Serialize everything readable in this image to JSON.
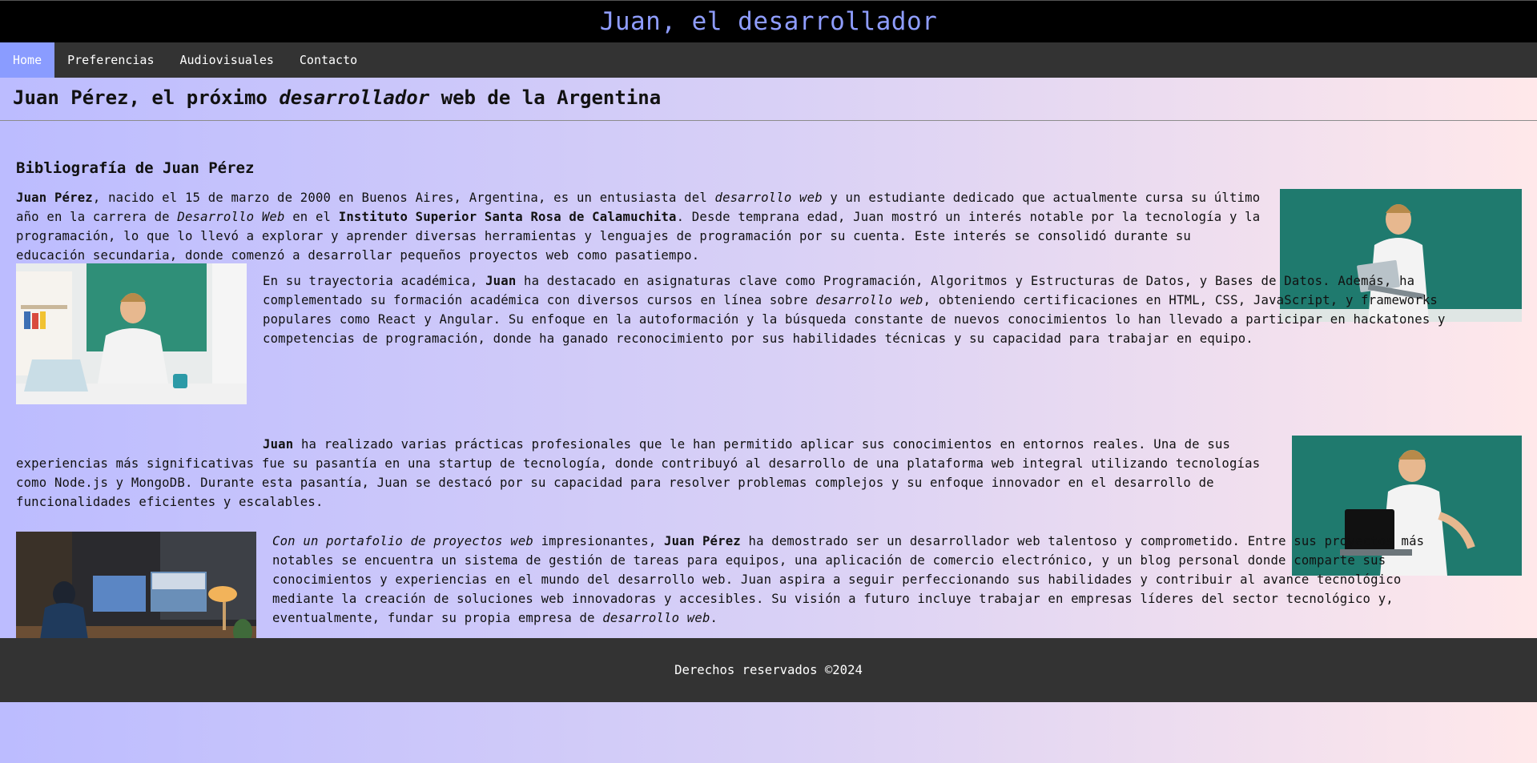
{
  "header": {
    "title": "Juan, el desarrollador"
  },
  "nav": {
    "items": [
      {
        "label": "Home"
      },
      {
        "label": "Preferencias"
      },
      {
        "label": "Audiovisuales"
      },
      {
        "label": "Contacto"
      }
    ]
  },
  "headline": {
    "before": "Juan Pérez, el próximo ",
    "em": "desarrollador",
    "after": " web de la Argentina"
  },
  "bio": {
    "title": "Bibliografía de Juan Pérez",
    "p1": {
      "a": "Juan Pérez",
      "b": ", nacido el 15 de marzo de 2000 en Buenos Aires, Argentina, es un entusiasta del ",
      "c": "desarrollo web",
      "d": " y un estudiante dedicado que actualmente cursa su último año en la carrera de ",
      "e": "Desarrollo Web",
      "f": " en el ",
      "g": "Instituto Superior Santa Rosa de Calamuchita",
      "h": ". Desde temprana edad, Juan mostró un interés notable por la tecnología y la programación, lo que lo llevó a explorar y aprender diversas herramientas y lenguajes de programación por su cuenta. Este interés se consolidó durante su educación secundaria, donde comenzó a desarrollar pequeños proyectos web como pasatiempo."
    },
    "p2": {
      "a": "En su trayectoria académica, ",
      "b": "Juan",
      "c": " ha destacado en asignaturas clave como Programación, Algoritmos y Estructuras de Datos, y Bases de Datos. Además, ha complementado su formación académica con diversos cursos en línea sobre ",
      "d": "desarrollo web",
      "e": ", obteniendo certificaciones en HTML, CSS, JavaScript, y frameworks populares como React y Angular. Su enfoque en la autoformación y la búsqueda constante de nuevos conocimientos lo han llevado a participar en hackatones y competencias de programación, donde ha ganado reconocimiento por sus habilidades técnicas y su capacidad para trabajar en equipo."
    },
    "p3": {
      "a": "Juan",
      "b": " ha realizado varias prácticas profesionales que le han permitido aplicar sus conocimientos en entornos reales. Una de sus experiencias más significativas fue su pasantía en una startup de tecnología, donde contribuyó al desarrollo de una plataforma web integral utilizando tecnologías como Node.js y MongoDB. Durante esta pasantía, Juan se destacó por su capacidad para resolver problemas complejos y su enfoque innovador en el desarrollo de funcionalidades eficientes y escalables."
    },
    "p4": {
      "a": "Con un portafolio de proyectos web",
      "b": " impresionantes, ",
      "c": "Juan Pérez",
      "d": " ha demostrado ser un desarrollador web talentoso y comprometido. Entre sus proyectos más notables se encuentra un sistema de gestión de tareas para equipos, una aplicación de comercio electrónico, y un blog personal donde comparte sus conocimientos y experiencias en el mundo del desarrollo web. Juan aspira a seguir perfeccionando sus habilidades y contribuir al avance tecnológico mediante la creación de soluciones web innovadoras y accesibles. Su visión a futuro incluye trabajar en empresas líderes del sector tecnológico y, eventualmente, fundar su propia empresa de ",
      "e": "desarrollo web",
      "f": "."
    }
  },
  "footer": {
    "text": "Derechos reservados ©2024"
  },
  "colors": {
    "header_bg": "#000000",
    "title": "#8f9dff",
    "nav_bg": "#333333",
    "nav_active": "#8a9cff",
    "footer_bg": "#333333"
  }
}
